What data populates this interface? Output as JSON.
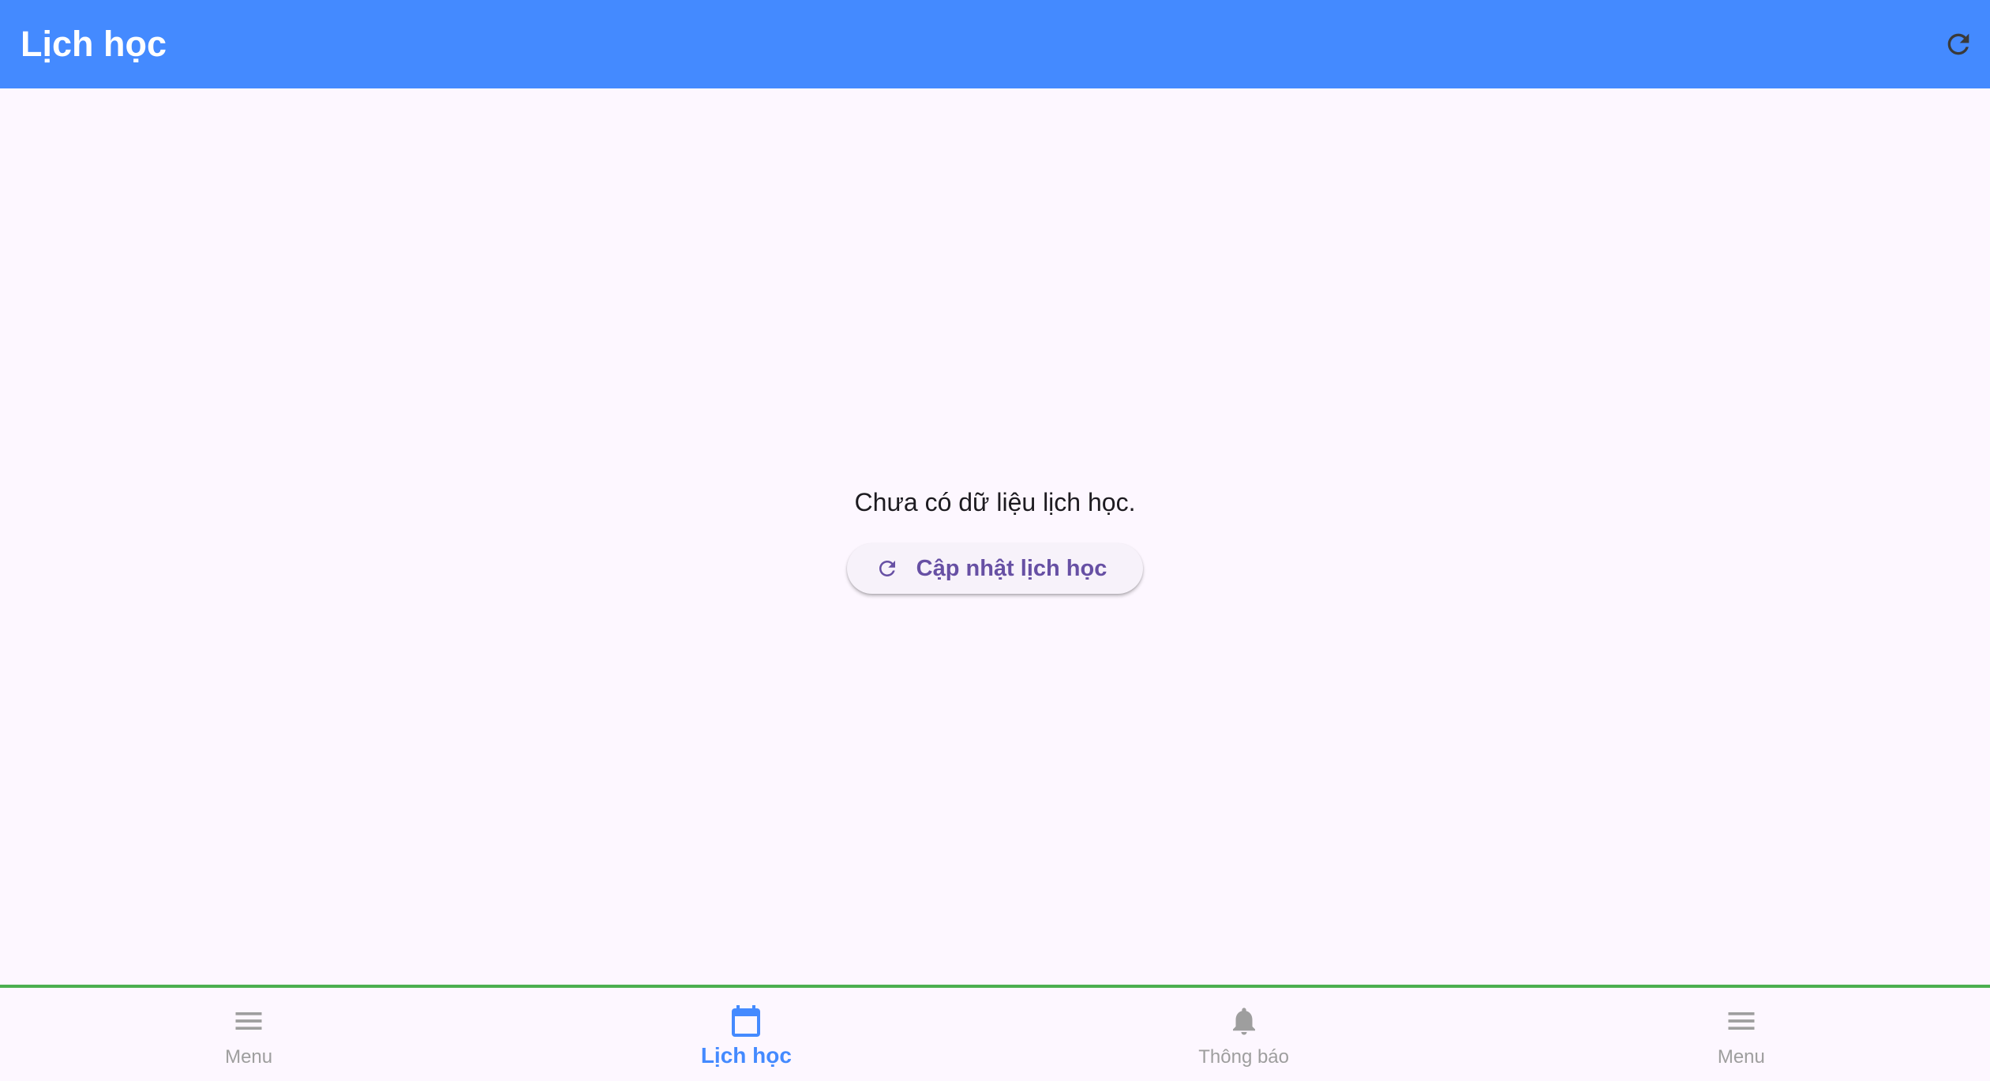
{
  "appbar": {
    "title": "Lịch học",
    "refresh_icon": "refresh-icon",
    "background": "#448aff"
  },
  "empty_state": {
    "message": "Chưa có dữ liệu lịch học.",
    "button_label": "Cập nhật lịch học",
    "button_icon": "refresh-icon"
  },
  "bottom_nav": {
    "items": [
      {
        "label": "Menu",
        "icon": "menu-icon",
        "active": false
      },
      {
        "label": "Lịch học",
        "icon": "calendar-icon",
        "active": true
      },
      {
        "label": "Thông báo",
        "icon": "bell-icon",
        "active": false
      },
      {
        "label": "Menu",
        "icon": "menu-icon",
        "active": false
      }
    ],
    "active_color": "#448aff",
    "inactive_color": "#9e9e9e",
    "top_border_color": "#4caf50"
  }
}
